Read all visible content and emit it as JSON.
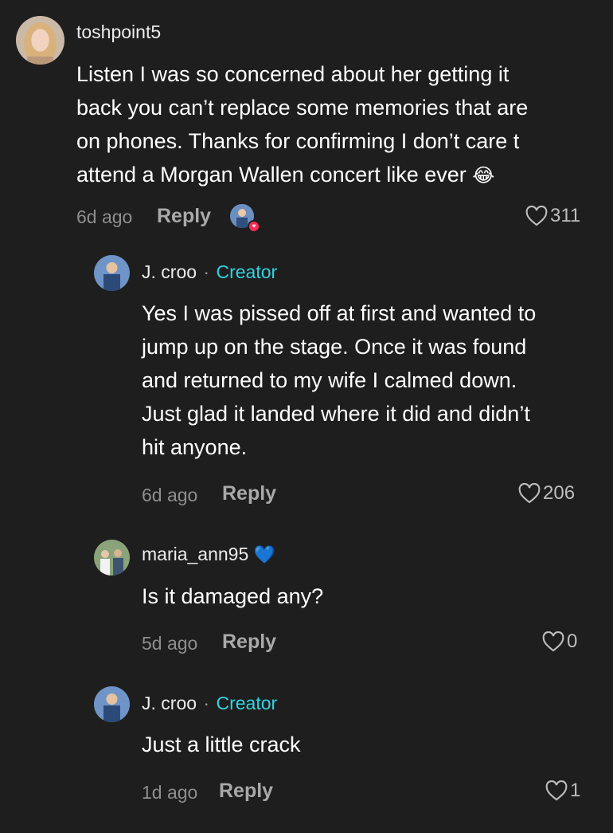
{
  "comments": [
    {
      "username": "toshpoint5",
      "text_lines": [
        "Listen I was so concerned about her getting it",
        "back you can’t replace some memories that are",
        "on phones. Thanks for confirming I don’t care t",
        "attend a Morgan Wallen concert like ever"
      ],
      "emoji": "😂",
      "time": "6d ago",
      "reply_label": "Reply",
      "likes": "311"
    },
    {
      "username": "J. croo",
      "dot": "·",
      "creator_label": "Creator",
      "text_lines": [
        "Yes I was pissed off at first and wanted to",
        "jump up on the stage. Once it was found",
        "and returned to my wife I calmed down.",
        "Just glad it landed where it did and didn’t",
        "hit anyone."
      ],
      "time": "6d ago",
      "reply_label": "Reply",
      "likes": "206"
    },
    {
      "username": "maria_ann95",
      "badge_emoji": "💙",
      "text_lines": [
        "Is it damaged any?"
      ],
      "time": "5d ago",
      "reply_label": "Reply",
      "likes": "0"
    },
    {
      "username": "J. croo",
      "dot": "·",
      "creator_label": "Creator",
      "text_lines": [
        "Just a little crack"
      ],
      "time": "1d ago",
      "reply_label": "Reply",
      "likes": "1"
    }
  ],
  "icons": {
    "like": "heart-outline-icon",
    "liked_by_creator": "creator-liked-icon"
  },
  "colors": {
    "background": "#1e1e1e",
    "creator": "#2fd3e2",
    "liked_badge": "#fe2c55"
  }
}
